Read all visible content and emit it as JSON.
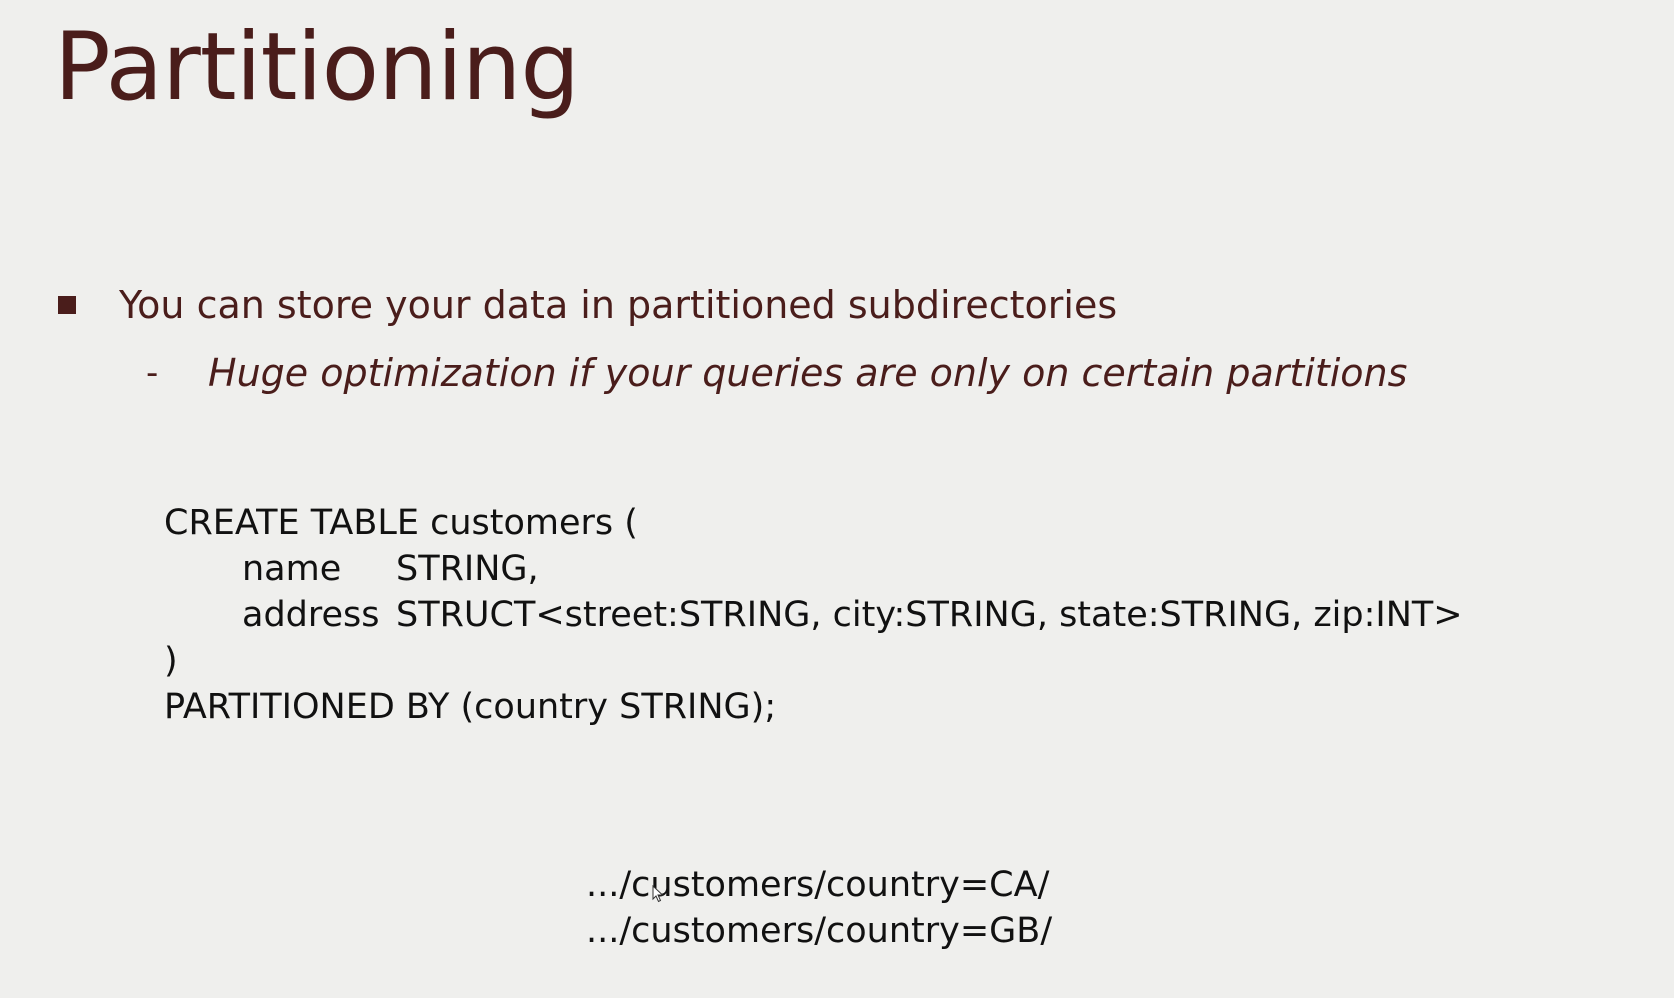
{
  "slide": {
    "title": "Partitioning",
    "bullets": [
      {
        "text": "You can store your data in partitioned subdirectories",
        "sub": "Huge optimization if your queries are only on certain partitions"
      }
    ],
    "code": {
      "line1": "CREATE TABLE customers (",
      "col1_name": "name",
      "col1_type": "STRING,",
      "col2_name": "address",
      "col2_type": "STRUCT<street:STRING, city:STRING, state:STRING, zip:INT>",
      "close_paren": ")",
      "partition_line": "PARTITIONED BY (country STRING);"
    },
    "paths": [
      ".../customers/country=CA/",
      ".../customers/country=GB/"
    ],
    "colors": {
      "background": "#efefed",
      "title": "#4a1d1b",
      "code_text": "#111111"
    },
    "icons": {
      "bullet": "square-bullet-icon",
      "cursor": "mouse-cursor-icon"
    }
  }
}
